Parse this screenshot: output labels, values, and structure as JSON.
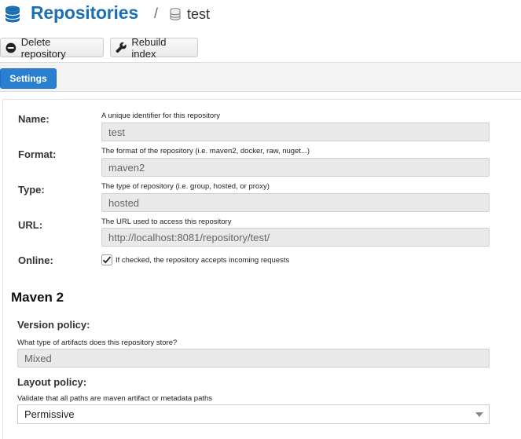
{
  "header": {
    "title": "Repositories",
    "separator": "/",
    "repo_name": "test"
  },
  "toolbar": {
    "delete_label": "Delete repository",
    "rebuild_label": "Rebuild index"
  },
  "tabs": [
    {
      "label": "Settings",
      "active": true
    }
  ],
  "form": {
    "name": {
      "label": "Name:",
      "help": "A unique identifier for this repository",
      "value": "test"
    },
    "format": {
      "label": "Format:",
      "help": "The format of the repository (i.e. maven2, docker, raw, nuget...)",
      "value": "maven2"
    },
    "type": {
      "label": "Type:",
      "help": "The type of repository (i.e. group, hosted, or proxy)",
      "value": "hosted"
    },
    "url": {
      "label": "URL:",
      "help": "The URL used to access this repository",
      "value": "http://localhost:8081/repository/test/"
    },
    "online": {
      "label": "Online:",
      "help": "If checked, the repository accepts incoming requests",
      "checked": true
    }
  },
  "maven": {
    "heading": "Maven 2",
    "version_policy": {
      "label": "Version policy:",
      "help": "What type of artifacts does this repository store?",
      "value": "Mixed"
    },
    "layout_policy": {
      "label": "Layout policy:",
      "help": "Validate that all paths are maven artifact or metadata paths",
      "value": "Permissive"
    }
  },
  "colors": {
    "title": "#1a6fb5",
    "tab_active": "#2b7fd0",
    "field_disabled": "#e9e9e9"
  }
}
